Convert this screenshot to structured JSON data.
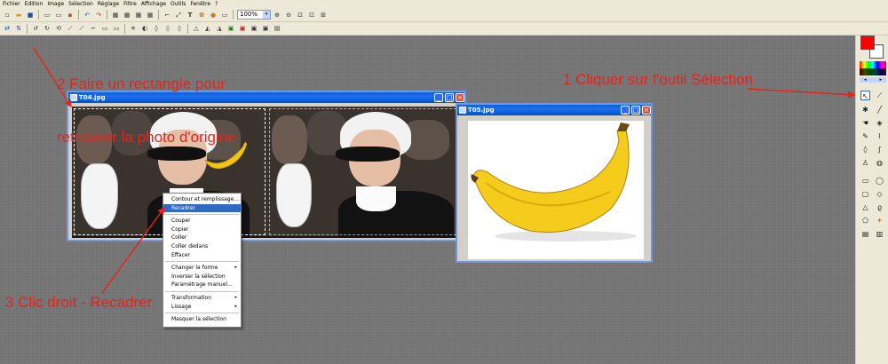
{
  "menubar": {
    "items": [
      "Fichier",
      "Edition",
      "Image",
      "Sélection",
      "Réglage",
      "Filtre",
      "Affichage",
      "Outils",
      "Fenêtre",
      "?"
    ]
  },
  "toolbar": {
    "zoom_value": "100%"
  },
  "window_left": {
    "title": "T04.jpg"
  },
  "window_right": {
    "title": "T05.jpg"
  },
  "context_menu": {
    "items": [
      "Contour et remplissage...",
      "Recadrer",
      "Couper",
      "Copier",
      "Coller",
      "Coller dedans",
      "Effacer",
      "Changer la forme",
      "Inverser la sélection",
      "Paramétrage manuel...",
      "Transformation",
      "Lissage",
      "Masquer la sélection"
    ]
  },
  "annotations": {
    "step1": "1 Cliquer sur l'outil Sélection",
    "step2_line1": "2 Faire un rectangle pour",
    "step2_line2": "retrouver la photo d'origine",
    "step3": "3 Clic droit - Recadrer"
  },
  "colors": {
    "annotation": "#e8231c",
    "foreground": "#ff0000",
    "background": "#ffffff",
    "menu_highlight": "#316ac5",
    "title_bar": "#0a61d8"
  },
  "icons": {
    "submenu": "▸",
    "minimize": "_",
    "maximize": "□",
    "close": "×",
    "dropdown": "▾"
  }
}
